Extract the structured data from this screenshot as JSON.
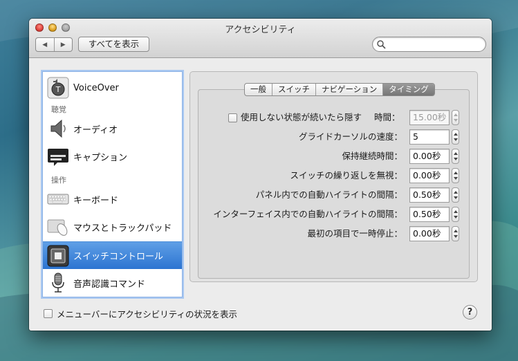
{
  "window": {
    "title": "アクセシビリティ",
    "back_glyph": "◀",
    "forward_glyph": "▶",
    "show_all_label": "すべてを表示",
    "search": {
      "value": "",
      "placeholder": ""
    }
  },
  "sidebar": {
    "items": [
      {
        "label": "VoiceOver",
        "icon": "voiceover-icon"
      },
      {
        "label": "オーディオ",
        "icon": "speaker-icon"
      },
      {
        "label": "キャプション",
        "icon": "caption-icon"
      },
      {
        "label": "キーボード",
        "icon": "keyboard-icon"
      },
      {
        "label": "マウスとトラックパッド",
        "icon": "mouse-trackpad-icon"
      },
      {
        "label": "スイッチコントロール",
        "icon": "switch-control-icon",
        "selected": true
      },
      {
        "label": "音声認識コマンド",
        "icon": "microphone-icon"
      }
    ],
    "sections": {
      "hearing": "聴覚",
      "interaction": "操作"
    }
  },
  "tabs": [
    {
      "label": "一般"
    },
    {
      "label": "スイッチ"
    },
    {
      "label": "ナビゲーション"
    },
    {
      "label": "タイミング",
      "active": true
    }
  ],
  "timing": {
    "hide_when_idle": {
      "label": "使用しない状態が続いたら隠す",
      "checked": false
    },
    "hide_time": {
      "label": "時間：",
      "value": "15.00秒",
      "enabled": false
    },
    "glide_speed": {
      "label": "グライドカーソルの速度：",
      "value": "5"
    },
    "hold_duration": {
      "label": "保持継続時間：",
      "value": "0.00秒"
    },
    "ignore_repeat": {
      "label": "スイッチの繰り返しを無視：",
      "value": "0.00秒"
    },
    "panel_highlight": {
      "label": "パネル内での自動ハイライトの間隔：",
      "value": "0.50秒"
    },
    "interface_highlight": {
      "label": "インターフェイス内での自動ハイライトの間隔：",
      "value": "0.50秒"
    },
    "first_item_pause": {
      "label": "最初の項目で一時停止：",
      "value": "0.00秒"
    }
  },
  "footer": {
    "show_status_menu": {
      "label": "メニューバーにアクセシビリティの状況を表示",
      "checked": false
    },
    "help_glyph": "?"
  },
  "colors": {
    "selection": "#2c74d1",
    "window_bg": "#ececec"
  }
}
